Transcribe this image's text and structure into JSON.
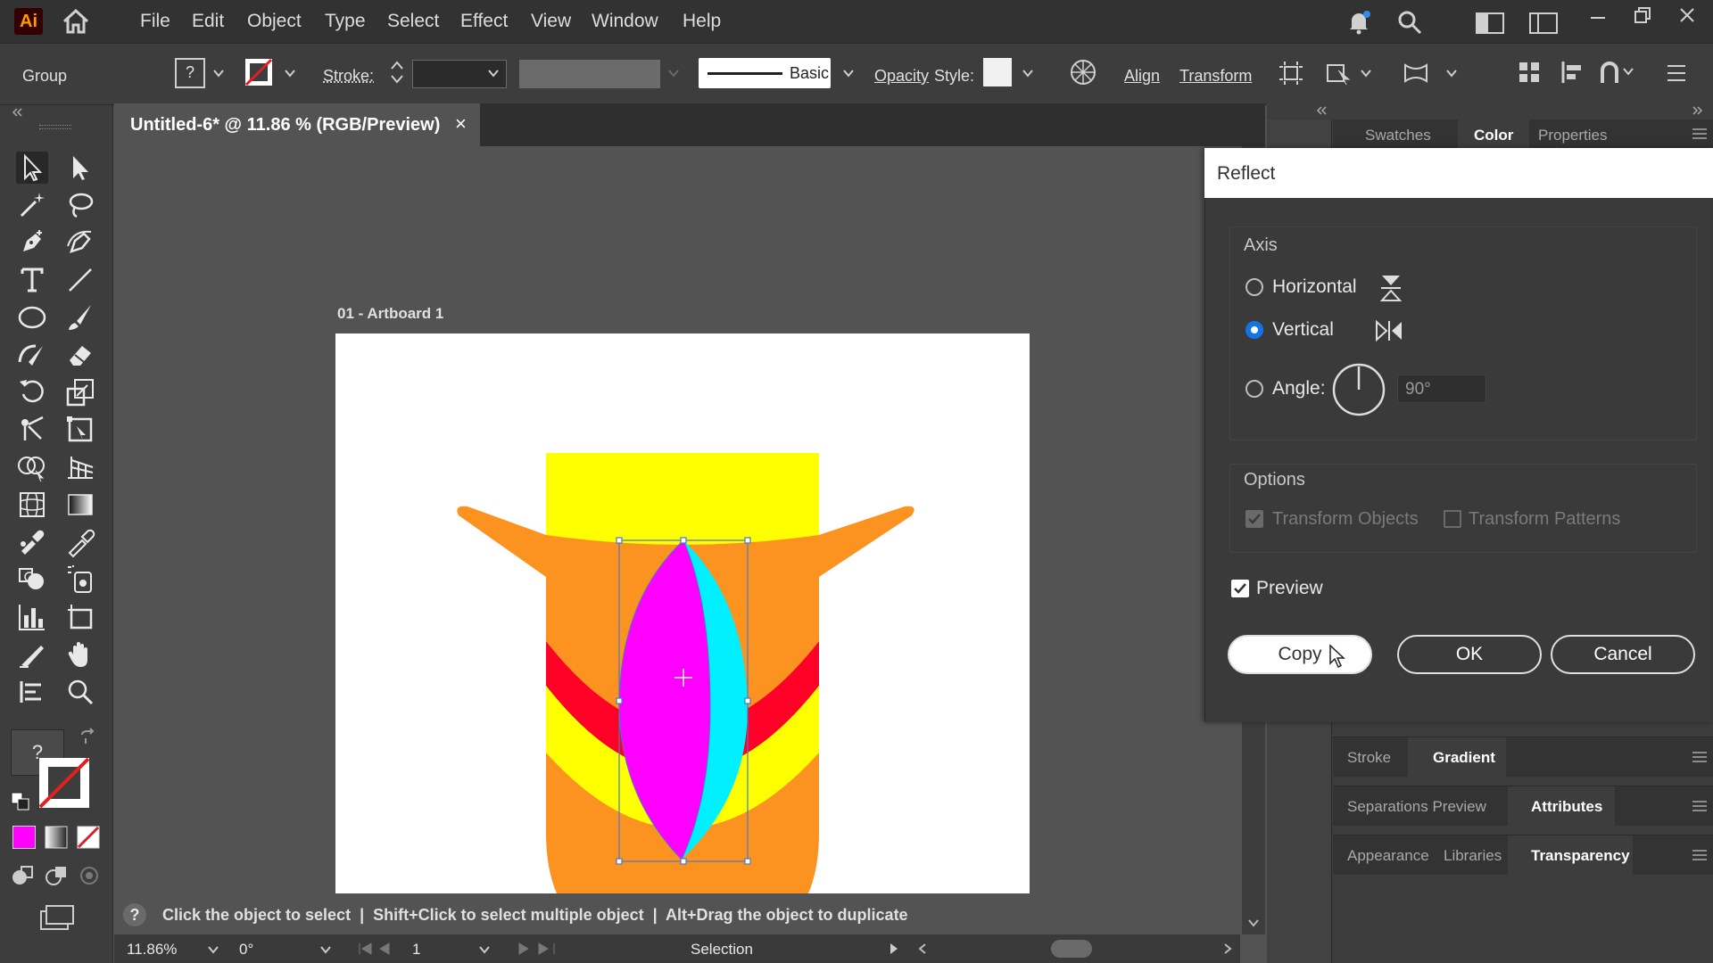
{
  "app": {
    "logo": "Ai"
  },
  "menu": [
    "File",
    "Edit",
    "Object",
    "Type",
    "Select",
    "Effect",
    "View",
    "Window",
    "Help"
  ],
  "control_bar": {
    "selection_type": "Group",
    "fill_label": "?",
    "stroke_label": "Stroke:",
    "brush_label": "Basic",
    "opacity_label": "Opacity",
    "style_label": "Style:",
    "align_label": "Align",
    "transform_label": "Transform"
  },
  "document": {
    "tab_title": "Untitled-6* @ 11.86 % (RGB/Preview)",
    "close": "×",
    "artboard_label": "01 - Artboard 1"
  },
  "status": {
    "help": "?",
    "hint": "Click the object to select  |  Shift+Click to select multiple object  |  Alt+Drag the object to duplicate",
    "zoom": "11.86%",
    "rotation": "0°",
    "artboard_num": "1",
    "tool": "Selection"
  },
  "toolbar": {
    "fill_question": "?"
  },
  "panels": {
    "top_tabs": [
      "Swatches",
      "Color",
      "Properties"
    ],
    "stroke_group": [
      "Stroke",
      "Gradient"
    ],
    "sep_group": [
      "Separations Preview",
      "Attributes"
    ],
    "appearance_group": [
      "Appearance",
      "Libraries",
      "Transparency"
    ]
  },
  "dialog": {
    "title": "Reflect",
    "axis_label": "Axis",
    "horizontal": "Horizontal",
    "vertical": "Vertical",
    "angle_label": "Angle:",
    "angle_value": "90°",
    "options_label": "Options",
    "transform_objects": "Transform Objects",
    "transform_patterns": "Transform Patterns",
    "preview": "Preview",
    "copy": "Copy",
    "ok": "OK",
    "cancel": "Cancel",
    "selected_axis": "vertical",
    "preview_checked": true
  },
  "colors": {
    "accent": "#1473e6",
    "yellow": "#ffff00",
    "orange": "#fc9220",
    "red": "#ff0026",
    "magenta": "#ff00ff",
    "cyan": "#00f0ff"
  }
}
